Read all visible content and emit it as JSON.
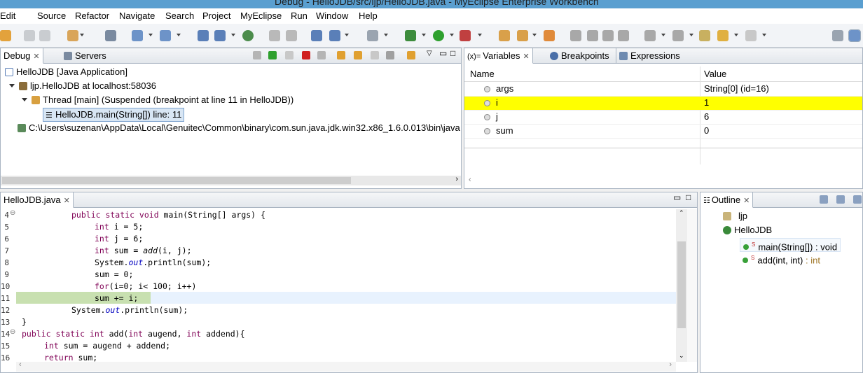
{
  "window": {
    "title": "Debug - HelloJDB/src/ljp/HelloJDB.java - MyEclipse Enterprise Workbench"
  },
  "menu": [
    "Edit",
    "Source",
    "Refactor",
    "Navigate",
    "Search",
    "Project",
    "MyEclipse",
    "Run",
    "Window",
    "Help"
  ],
  "debug_view": {
    "tabs": [
      {
        "label": "Debug"
      },
      {
        "label": "Servers"
      }
    ],
    "tree": [
      {
        "label": "HelloJDB [Java Application]",
        "icon": "java-app-icon"
      },
      {
        "label": "ljp.HelloJDB at localhost:58036",
        "icon": "debug-target-icon"
      },
      {
        "label": "Thread [main] (Suspended (breakpoint at line 11 in HelloJDB))",
        "icon": "thread-suspended-icon"
      },
      {
        "label": "HelloJDB.main(String[]) line: 11",
        "icon": "stack-frame-icon"
      },
      {
        "label": "C:\\Users\\suzenan\\AppData\\Local\\Genuitec\\Common\\binary\\com.sun.java.jdk.win32.x86_1.6.0.013\\bin\\java",
        "icon": "process-icon"
      }
    ]
  },
  "variables_view": {
    "tabs": [
      {
        "label": "Variables"
      },
      {
        "label": "Breakpoints"
      },
      {
        "label": "Expressions"
      }
    ],
    "columns": [
      "Name",
      "Value"
    ],
    "rows": [
      {
        "name": "args",
        "value": "String[0]  (id=16)",
        "highlight": false
      },
      {
        "name": "i",
        "value": "1",
        "highlight": true
      },
      {
        "name": "j",
        "value": "6",
        "highlight": false
      },
      {
        "name": "sum",
        "value": "0",
        "highlight": false
      }
    ],
    "highlight_color": "#ffff00"
  },
  "editor": {
    "tab": "HelloJDB.java",
    "lines": [
      {
        "n": "4",
        "text": "public static void main(String[] args) {"
      },
      {
        "n": "5",
        "text": "int i = 5;"
      },
      {
        "n": "6",
        "text": "int j = 6;"
      },
      {
        "n": "7",
        "text": "int sum = add(i, j);"
      },
      {
        "n": "8",
        "text": "System.out.println(sum);"
      },
      {
        "n": "9",
        "text": "sum = 0;"
      },
      {
        "n": "10",
        "text": "for(i=0; i< 100; i++)"
      },
      {
        "n": "11",
        "text": "sum += i;"
      },
      {
        "n": "12",
        "text": "System.out.println(sum);"
      },
      {
        "n": "13",
        "text": "}"
      },
      {
        "n": "14",
        "text": "public static int add(int augend, int addend){"
      },
      {
        "n": "15",
        "text": "int sum = augend + addend;"
      },
      {
        "n": "16",
        "text": "return sum;"
      }
    ],
    "current_line": "11",
    "current_line_color": "#c8e0b0"
  },
  "outline_view": {
    "tab": "Outline",
    "items": [
      {
        "label": "ljp",
        "type": ""
      },
      {
        "label": "HelloJDB",
        "type": ""
      },
      {
        "label": "main(String[]) : void",
        "type": ""
      },
      {
        "label": "add(int, int)",
        "type": ": int"
      }
    ]
  }
}
